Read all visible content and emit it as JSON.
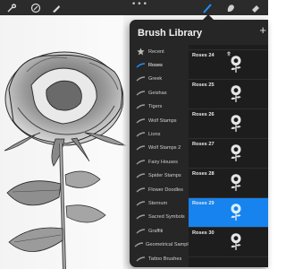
{
  "panel": {
    "title": "Brush Library",
    "plus_icon": "plus-icon"
  },
  "toolbar": {
    "left_icons": [
      "wrench-icon",
      "adjustments-icon",
      "selection-icon",
      "transform-icon"
    ],
    "more_dots": "•••",
    "right_icons": [
      "brush-icon",
      "smudge-icon",
      "eraser-icon"
    ],
    "active_tool": "brush-icon",
    "accent_color": "#1e90ff"
  },
  "categories": [
    {
      "label": "Recent",
      "icon": "star-icon"
    },
    {
      "label": "Roses",
      "icon": "stroke-icon",
      "active": true
    },
    {
      "label": "Greek",
      "icon": "stroke-icon"
    },
    {
      "label": "Geishas",
      "icon": "stroke-icon"
    },
    {
      "label": "Tigers",
      "icon": "stroke-icon"
    },
    {
      "label": "Wolf Stamps",
      "icon": "stroke-icon"
    },
    {
      "label": "Lions",
      "icon": "stroke-icon"
    },
    {
      "label": "Wolf Stamps 2",
      "icon": "stroke-icon"
    },
    {
      "label": "Fairy Houses",
      "icon": "stroke-icon"
    },
    {
      "label": "Spider Stamps",
      "icon": "stroke-icon"
    },
    {
      "label": "Flower Doodles",
      "icon": "stroke-icon"
    },
    {
      "label": "Sternum",
      "icon": "stroke-icon"
    },
    {
      "label": "Sacred Symbols",
      "icon": "stroke-icon"
    },
    {
      "label": "Graffiti",
      "icon": "stroke-icon"
    },
    {
      "label": "Geometrical Samples",
      "icon": "stroke-icon"
    },
    {
      "label": "Tattoo Brushes",
      "icon": "stroke-icon"
    }
  ],
  "brushes": [
    {
      "label": "",
      "preview": "rose-stamp-icon"
    },
    {
      "label": "Roses 24",
      "preview": "rose-stamp-icon"
    },
    {
      "label": "Roses 25",
      "preview": "rose-stamp-icon"
    },
    {
      "label": "Roses 26",
      "preview": "rose-stamp-icon"
    },
    {
      "label": "Roses 27",
      "preview": "rose-stamp-icon"
    },
    {
      "label": "Roses 28",
      "preview": "rose-stamp-icon"
    },
    {
      "label": "Roses 29",
      "preview": "rose-stamp-icon",
      "selected": true
    },
    {
      "label": "Roses 30",
      "preview": "rose-stamp-icon"
    }
  ]
}
